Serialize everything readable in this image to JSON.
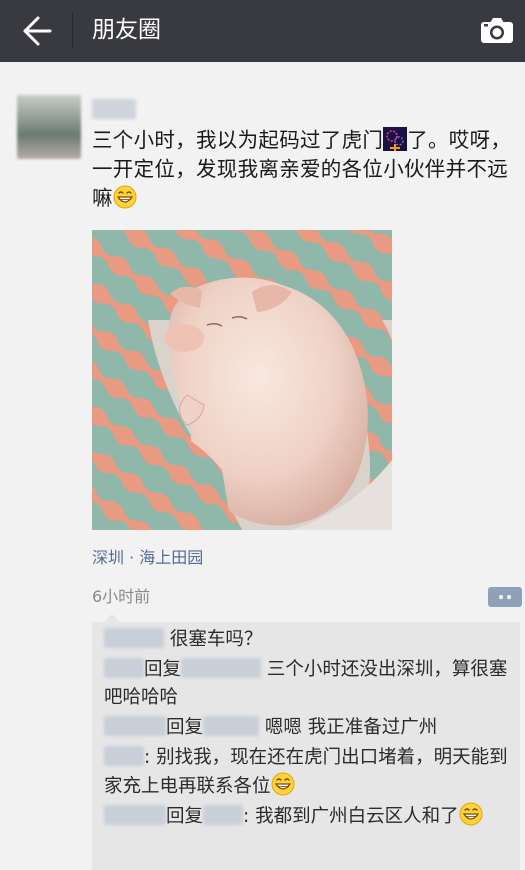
{
  "header": {
    "title": "朋友圈"
  },
  "post": {
    "text_before_emoji": "三个小时，我以为起码过了虎门",
    "text_after_emoji": "了。哎呀，一开定位，发现我离亲爱的各位小伙伴并不远嘛",
    "location": "深圳 · 海上田园",
    "time": "6小时前"
  },
  "comments": {
    "c1": {
      "text": "很塞车吗？"
    },
    "c2": {
      "reply": "回复",
      "text": "三个小时还没出深圳，算很塞吧哈哈哈"
    },
    "c3": {
      "reply": "回复",
      "text": "嗯嗯 我正准备过广州"
    },
    "c4": {
      "text": ":  别找我，现在还在虎门出口堵着，明天能到家充上电再联系各位"
    },
    "c5": {
      "reply": "回复",
      "text": ":  我都到广州白云区人和了"
    }
  }
}
